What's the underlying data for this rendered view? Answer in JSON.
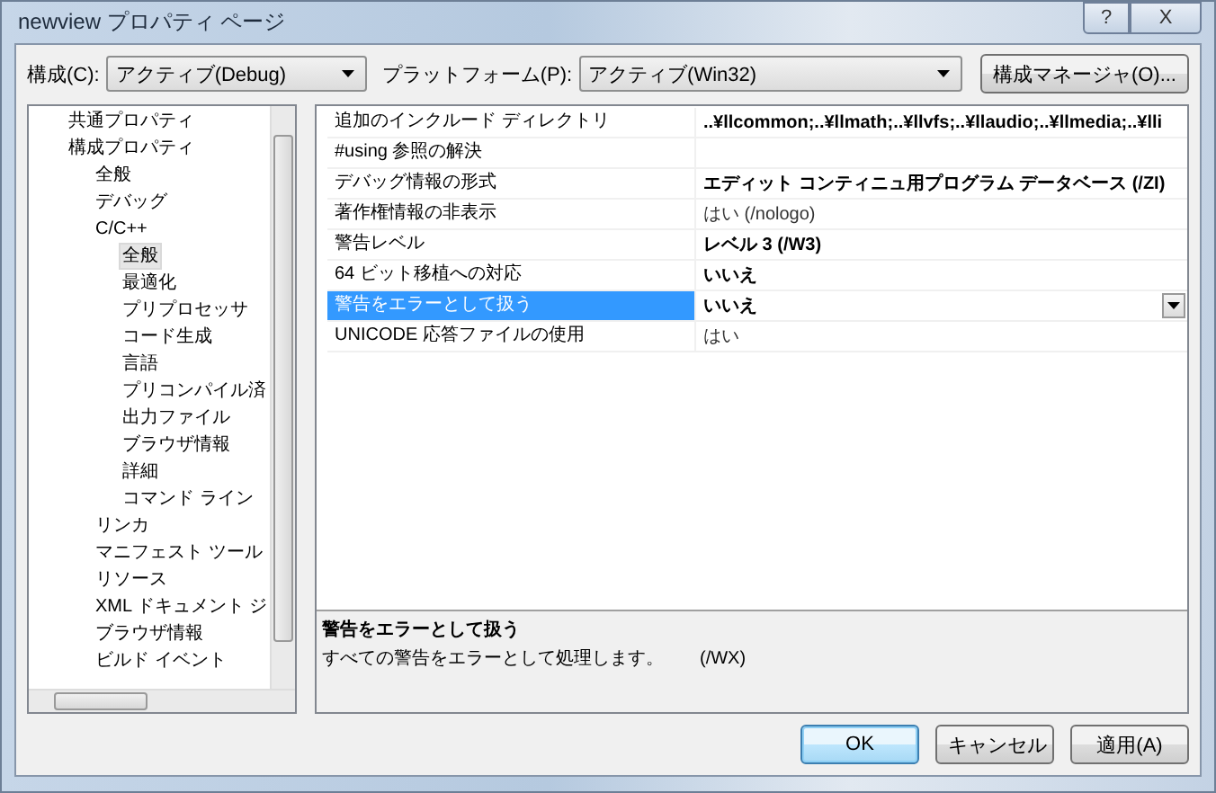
{
  "window": {
    "title": "newview プロパティ ページ",
    "buttons": [
      "?",
      "X"
    ]
  },
  "config": {
    "label": "構成(C):",
    "value": "アクティブ(Debug)"
  },
  "platform": {
    "label": "プラットフォーム(P):",
    "value": "アクティブ(Win32)"
  },
  "config_manager_button": "構成マネージャ(O)...",
  "tree": [
    {
      "label": "共通プロパティ",
      "selected": false
    },
    {
      "label": "構成プロパティ",
      "selected": false,
      "children": [
        {
          "label": "全般",
          "selected": false
        },
        {
          "label": "デバッグ",
          "selected": false
        },
        {
          "label": "C/C++",
          "selected": false,
          "children": [
            {
              "label": "全般",
              "selected": true
            },
            {
              "label": "最適化",
              "selected": false
            },
            {
              "label": "プリプロセッサ",
              "selected": false
            },
            {
              "label": "コード生成",
              "selected": false
            },
            {
              "label": "言語",
              "selected": false
            },
            {
              "label": "プリコンパイル済",
              "selected": false
            },
            {
              "label": "出力ファイル",
              "selected": false
            },
            {
              "label": "ブラウザ情報",
              "selected": false
            },
            {
              "label": "詳細",
              "selected": false
            },
            {
              "label": "コマンド ライン",
              "selected": false
            }
          ]
        },
        {
          "label": "リンカ",
          "selected": false
        },
        {
          "label": "マニフェスト ツール",
          "selected": false
        },
        {
          "label": "リソース",
          "selected": false
        },
        {
          "label": "XML ドキュメント ジ",
          "selected": false
        },
        {
          "label": "ブラウザ情報",
          "selected": false
        },
        {
          "label": "ビルド イベント",
          "selected": false
        }
      ]
    }
  ],
  "properties": [
    {
      "name": "追加のインクルード ディレクトリ",
      "value": "..¥llcommon;..¥llmath;..¥llvfs;..¥llaudio;..¥llmedia;..¥lli",
      "bold": true,
      "selected": false
    },
    {
      "name": "#using 参照の解決",
      "selected": false
    },
    {
      "name": "デバッグ情報の形式",
      "value": "エディット コンティニュ用プログラム データベース (/ZI)",
      "bold": true,
      "selected": false
    },
    {
      "name": "著作権情報の非表示",
      "value": "はい (/nologo)",
      "bold": false,
      "selected": false
    },
    {
      "name": "警告レベル",
      "value": "レベル 3 (/W3)",
      "bold": true,
      "selected": false
    },
    {
      "name": "64 ビット移植への対応",
      "value": "いいえ",
      "bold": true,
      "selected": false
    },
    {
      "name": "警告をエラーとして扱う",
      "value": "いいえ",
      "bold": true,
      "selected": true
    },
    {
      "name": "UNICODE 応答ファイルの使用",
      "value": "はい",
      "bold": false,
      "selected": false
    }
  ],
  "description": {
    "title": "警告をエラーとして扱う",
    "text": "すべての警告をエラーとして処理します。　　(/WX)"
  },
  "buttons": [
    {
      "label": "OK",
      "default": true
    },
    {
      "label": "キャンセル",
      "default": false
    },
    {
      "label": "適用(A)",
      "default": false
    }
  ]
}
